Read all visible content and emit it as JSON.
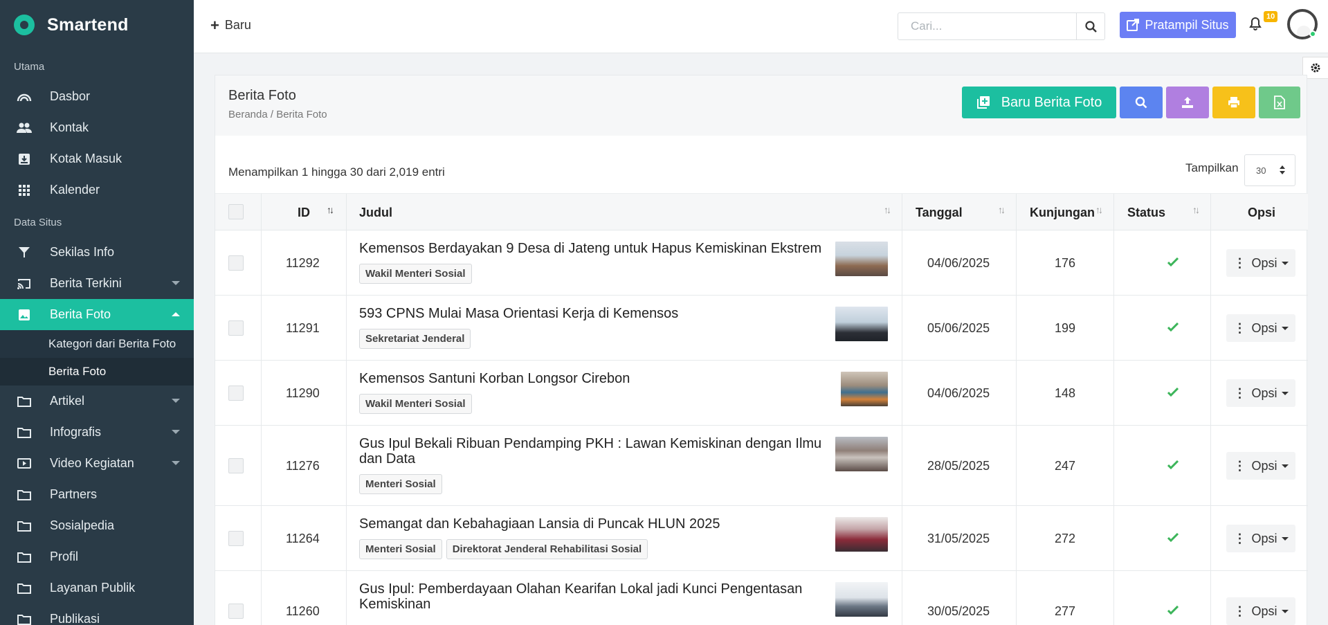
{
  "brand": {
    "name": "Smartend"
  },
  "sidebar": {
    "section_main": "Utama",
    "main_items": [
      {
        "label": "Dasbor",
        "icon": "dashboard-icon"
      },
      {
        "label": "Kontak",
        "icon": "contacts-icon"
      },
      {
        "label": "Kotak Masuk",
        "icon": "inbox-icon"
      },
      {
        "label": "Kalender",
        "icon": "calendar-grid-icon"
      }
    ],
    "section_site": "Data Situs",
    "site_items": [
      {
        "label": "Sekilas Info",
        "icon": "filter-icon"
      },
      {
        "label": "Berita Terkini",
        "icon": "cast-icon"
      },
      {
        "label": "Berita Foto",
        "icon": "photo-icon"
      },
      {
        "label": "Artikel",
        "icon": "folder-icon"
      },
      {
        "label": "Infografis",
        "icon": "folder-icon"
      },
      {
        "label": "Video Kegiatan",
        "icon": "video-icon"
      },
      {
        "label": "Partners",
        "icon": "folder-icon"
      },
      {
        "label": "Sosialpedia",
        "icon": "folder-icon"
      },
      {
        "label": "Profil",
        "icon": "folder-icon"
      },
      {
        "label": "Layanan Publik",
        "icon": "folder-icon"
      },
      {
        "label": "Publikasi",
        "icon": "folder-icon"
      }
    ],
    "sub_items": [
      {
        "label": "Kategori dari Berita Foto"
      },
      {
        "label": "Berita Foto"
      }
    ]
  },
  "header": {
    "new_label": "Baru",
    "search_placeholder": "Cari...",
    "preview_label": "Pratampil Situs",
    "notif_count": "10"
  },
  "page": {
    "title": "Berita Foto",
    "breadcrumb": "Beranda / Berita Foto",
    "new_button_label": "Baru Berita Foto",
    "info_text": "Menampilkan 1 hingga 30 dari 2,019 entri",
    "show_label": "Tampilkan",
    "page_size": "30"
  },
  "table": {
    "columns": {
      "id": "ID",
      "title": "Judul",
      "date": "Tanggal",
      "visits": "Kunjungan",
      "status": "Status",
      "options": "Opsi"
    },
    "option_label": "Opsi",
    "rows": [
      {
        "id": "11292",
        "title": "Kemensos Berdayakan 9 Desa di Jateng untuk Hapus Kemiskinan Ekstrem",
        "tags": [
          "Wakil Menteri Sosial"
        ],
        "date": "04/06/2025",
        "visits": "176",
        "active": true
      },
      {
        "id": "11291",
        "title": "593 CPNS Mulai Masa Orientasi Kerja di Kemensos",
        "tags": [
          "Sekretariat Jenderal"
        ],
        "date": "05/06/2025",
        "visits": "199",
        "active": true
      },
      {
        "id": "11290",
        "title": "Kemensos Santuni Korban Longsor Cirebon",
        "tags": [
          "Wakil Menteri Sosial"
        ],
        "date": "04/06/2025",
        "visits": "148",
        "active": true
      },
      {
        "id": "11276",
        "title": "Gus Ipul Bekali Ribuan Pendamping PKH : Lawan Kemiskinan dengan Ilmu dan Data",
        "tags": [
          "Menteri Sosial"
        ],
        "date": "28/05/2025",
        "visits": "247",
        "active": true
      },
      {
        "id": "11264",
        "title": "Semangat dan Kebahagiaan Lansia di Puncak HLUN 2025",
        "tags": [
          "Menteri Sosial",
          "Direktorat Jenderal Rehabilitasi Sosial"
        ],
        "date": "31/05/2025",
        "visits": "272",
        "active": true
      },
      {
        "id": "11260",
        "title": "Gus Ipul: Pemberdayaan Olahan Kearifan Lokal jadi Kunci Pengentasan Kemiskinan",
        "tags": [],
        "date": "30/05/2025",
        "visits": "277",
        "active": true
      }
    ]
  },
  "colors": {
    "sidebar_bg": "#2a3b47",
    "accent": "#1cbfa0",
    "preview_btn": "#6c7ef5",
    "search_btn": "#5c84f0",
    "upload_btn": "#b07fe0",
    "print_btn": "#f7c11a",
    "excel_btn": "#6fc98a",
    "status_check": "#3cb55a"
  }
}
